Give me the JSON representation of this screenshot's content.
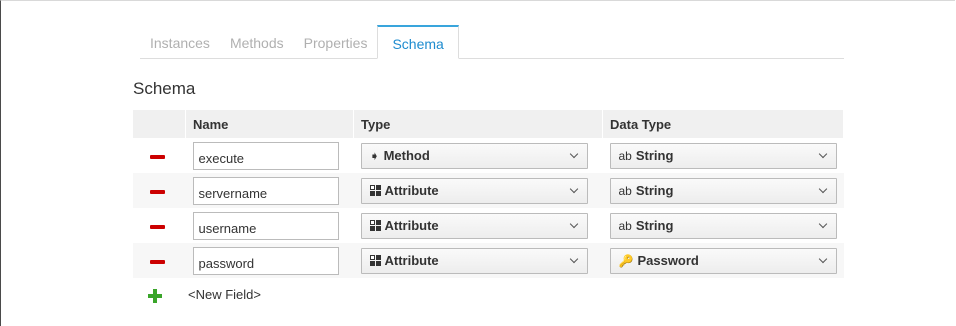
{
  "tabs": [
    {
      "label": "Instances",
      "active": false
    },
    {
      "label": "Methods",
      "active": false
    },
    {
      "label": "Properties",
      "active": false
    },
    {
      "label": "Schema",
      "active": true
    }
  ],
  "section_title": "Schema",
  "table": {
    "headers": [
      "",
      "Name",
      "Type",
      "Data Type"
    ],
    "rows": [
      {
        "name": "execute",
        "type": "Method",
        "type_icon": "method-icon",
        "data_type_prefix": "ab",
        "data_type": "String",
        "data_type_icon": "string-icon"
      },
      {
        "name": "servername",
        "type": "Attribute",
        "type_icon": "attribute-icon",
        "data_type_prefix": "ab",
        "data_type": "String",
        "data_type_icon": "string-icon"
      },
      {
        "name": "username",
        "type": "Attribute",
        "type_icon": "attribute-icon",
        "data_type_prefix": "ab",
        "data_type": "String",
        "data_type_icon": "string-icon"
      },
      {
        "name": "password",
        "type": "Attribute",
        "type_icon": "attribute-icon",
        "data_type_prefix": "",
        "data_type": "Password",
        "data_type_icon": "key-icon"
      }
    ]
  },
  "new_field_label": "<New Field>",
  "colors": {
    "active_tab": "#1e8ccf",
    "remove": "#cc0000",
    "add": "#3aa52a"
  }
}
